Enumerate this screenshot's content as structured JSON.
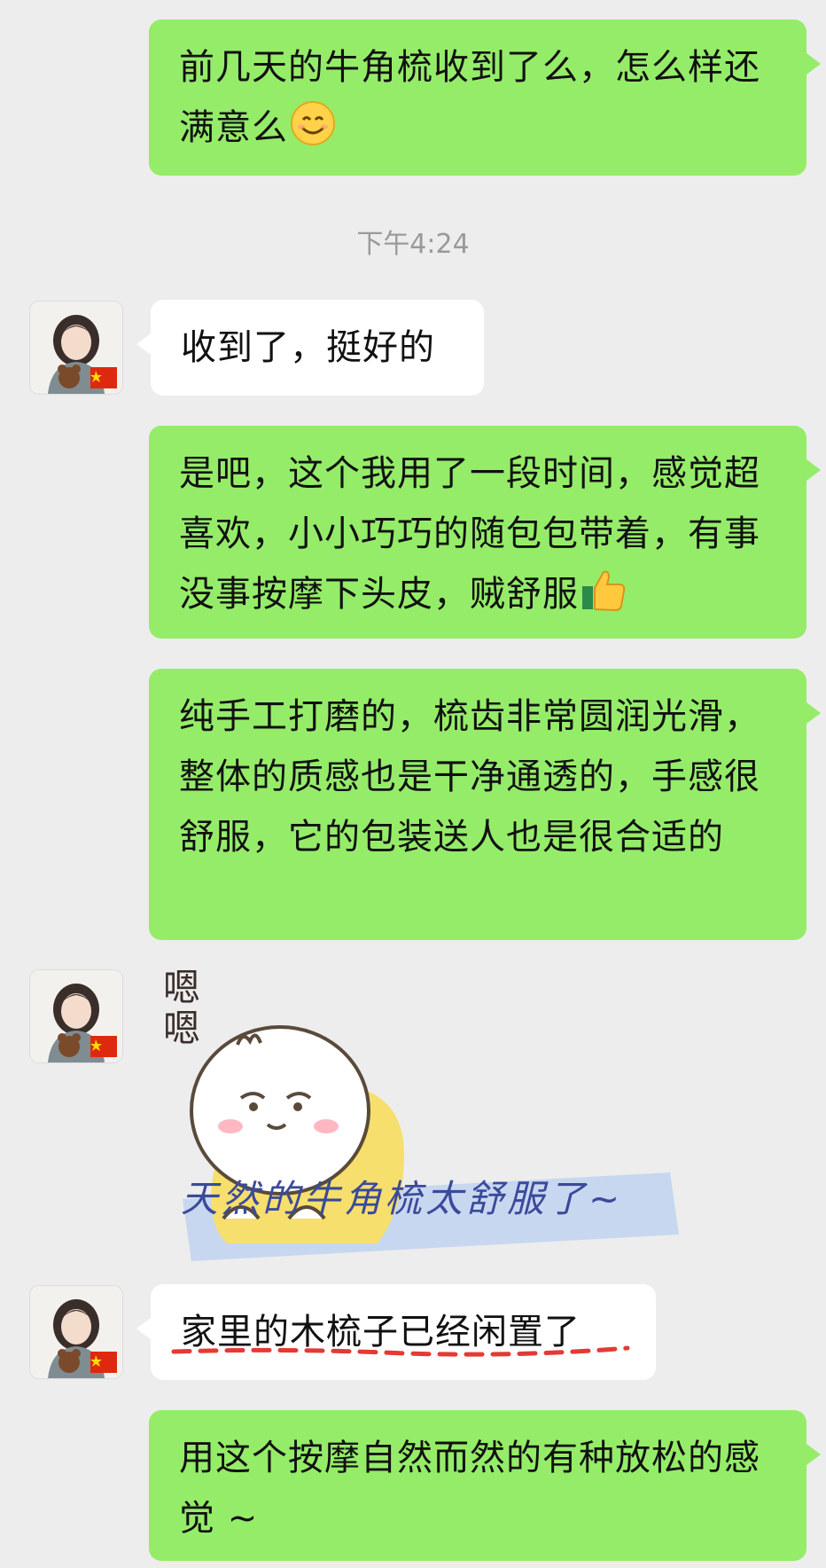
{
  "messages": [
    {
      "side": "out",
      "text": "前几天的牛角梳收到了么，怎么样还满意么"
    },
    {
      "side": "in",
      "text": "收到了，挺好的"
    },
    {
      "side": "out",
      "text": "是吧，这个我用了一段时间，感觉超喜欢，小小巧巧的随包包带着，有事没事按摩下头皮，贼舒服"
    },
    {
      "side": "out",
      "text": "纯手工打磨的，梳齿非常圆润光滑，整体的质感也是干净通透的，手感很舒服，它的包装送人也是很合适的"
    },
    {
      "side": "in",
      "type": "sticker",
      "sticker_text": "嗯嗯",
      "caption": "天然的牛角梳太舒服了~"
    },
    {
      "side": "in",
      "text": "家里的木梳子已经闲置了"
    },
    {
      "side": "out",
      "text": "用这个按摩自然而然的有种放松的感觉 ~"
    }
  ],
  "timestamp": "下午4:24",
  "icons": {
    "smile": "smiling-face-emoji",
    "thumbs": "thumbs-up-emoji",
    "avatar": "user-avatar",
    "flag": "china-flag-icon"
  },
  "colors": {
    "outgoing": "#95ec69",
    "incoming": "#ffffff",
    "background": "#ededed",
    "underline": "#e53935"
  }
}
